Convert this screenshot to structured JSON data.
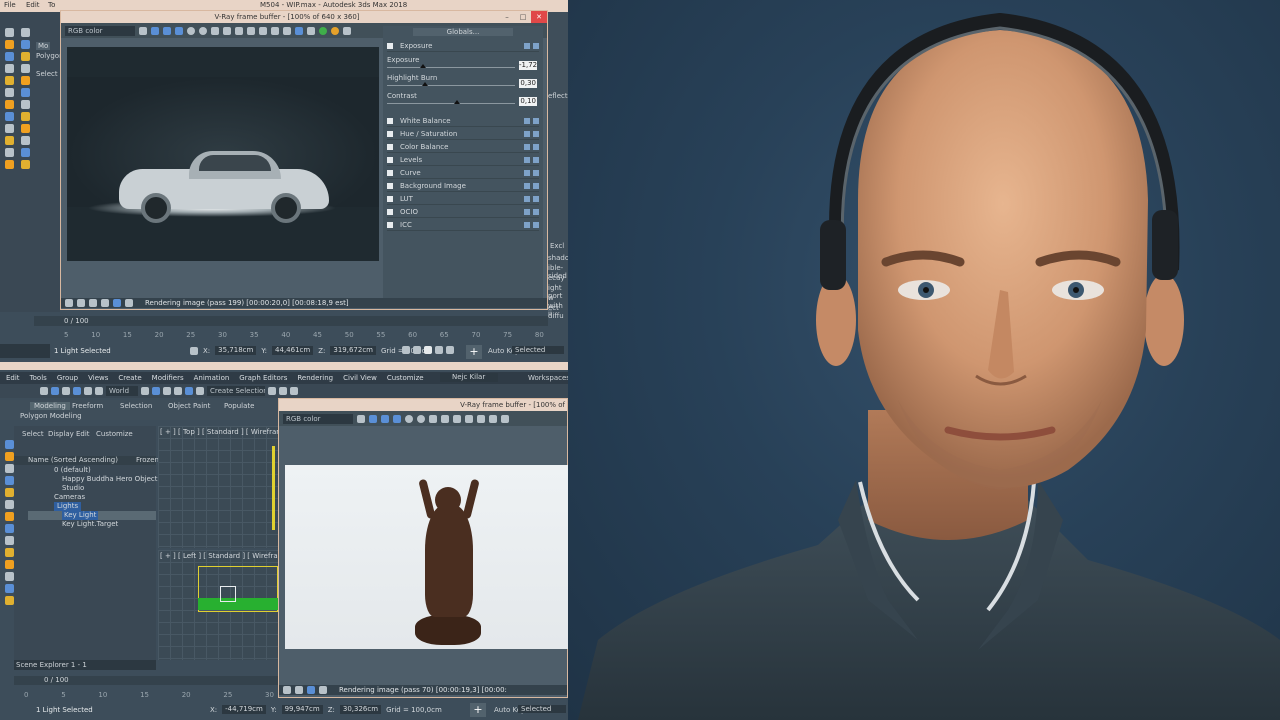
{
  "top_window": {
    "title": "M504 - WIP.max - Autodesk 3ds Max 2018",
    "menu": [
      "File",
      "Edit",
      "To"
    ],
    "ribbon_tabs": [
      "Mo",
      "Polygon",
      "Select"
    ]
  },
  "vfb_top": {
    "title": "V-Ray frame buffer - [100% of 640 x 360]",
    "channel": "RGB color",
    "panel_title": "Globals...",
    "exposure_label": "Exposure",
    "sliders": [
      {
        "name": "Exposure",
        "value": "-1,72",
        "level": 0.28
      },
      {
        "name": "Highlight Burn",
        "value": "0,30",
        "level": 0.3
      },
      {
        "name": "Contrast",
        "value": "0,10",
        "level": 0.55
      }
    ],
    "layers": [
      "White Balance",
      "Hue / Saturation",
      "Color Balance",
      "Levels",
      "Curve",
      "Background Image",
      "LUT",
      "OCIO",
      "ICC"
    ],
    "status": "Rendering image (pass 199) [00:00:20,0] [00:08:18,9 est]"
  },
  "side_panel_right": [
    "Excl",
    "shadov",
    "ible-sided",
    "ecay",
    "ight port",
    "w with ii",
    "ect diffu",
    "eflection"
  ],
  "top_timeline": {
    "frame": "0 / 100",
    "ticks": [
      "5",
      "10",
      "15",
      "20",
      "25",
      "30",
      "35",
      "40",
      "45",
      "50",
      "55",
      "60",
      "65",
      "70",
      "75",
      "80"
    ]
  },
  "top_status": {
    "selection": "1 Light Selected",
    "x": "35,718cm",
    "y": "44,461cm",
    "z": "319,672cm",
    "grid": "Grid = 10,0cm",
    "autokey": "Auto Key",
    "selected": "Selected"
  },
  "bottom_window": {
    "menu": [
      "Edit",
      "Tools",
      "Group",
      "Views",
      "Create",
      "Modifiers",
      "Animation",
      "Graph Editors",
      "Rendering",
      "Civil View",
      "Customize"
    ],
    "user": "Nejc Kilar",
    "workspaces": "Workspaces:",
    "ribbon_tabs": [
      "Modeling",
      "Freeform",
      "Selection",
      "Object Paint",
      "Populate"
    ],
    "ribbon_sub": "Polygon Modeling",
    "view_dropdown": "World",
    "selection_set": "Create Selection Se",
    "explorer_menu": [
      "Select",
      "Display",
      "Edit",
      "Customize"
    ],
    "tree_header": "Name (Sorted Ascending)",
    "tree_frozen": "Frozen",
    "tree": [
      "0 (default)",
      "Happy Buddha Hero Object",
      "Studio",
      "Cameras",
      "Lights",
      "Key Light",
      "Key Light.Target"
    ],
    "viewport_top": "[ + ] [ Top ] [ Standard ] [ Wireframe ]",
    "viewport_left": "[ + ] [ Left ] [ Standard ] [ Wireframe ]",
    "scene_explorer": "Scene Explorer 1 - 1",
    "frame": "0 / 100",
    "ticks": [
      "0",
      "5",
      "10",
      "15",
      "20",
      "25",
      "30"
    ],
    "status": {
      "selection": "1 Light Selected",
      "x": "-44,719cm",
      "y": "99,947cm",
      "z": "30,326cm",
      "grid": "Grid = 100,0cm",
      "autokey": "Auto Key",
      "selected": "Selected"
    }
  },
  "vfb_bottom": {
    "title": "V-Ray frame buffer - [100% of",
    "channel": "RGB color",
    "status": "Rendering image (pass 70) [00:00:19,3] [00:00:"
  },
  "colors": {
    "app_bg": "#3d4d5a",
    "titlebar": "#e8d4c6",
    "accent_blue": "#5a8fd6",
    "close_red": "#e04848",
    "portrait_bg": "#284158"
  }
}
